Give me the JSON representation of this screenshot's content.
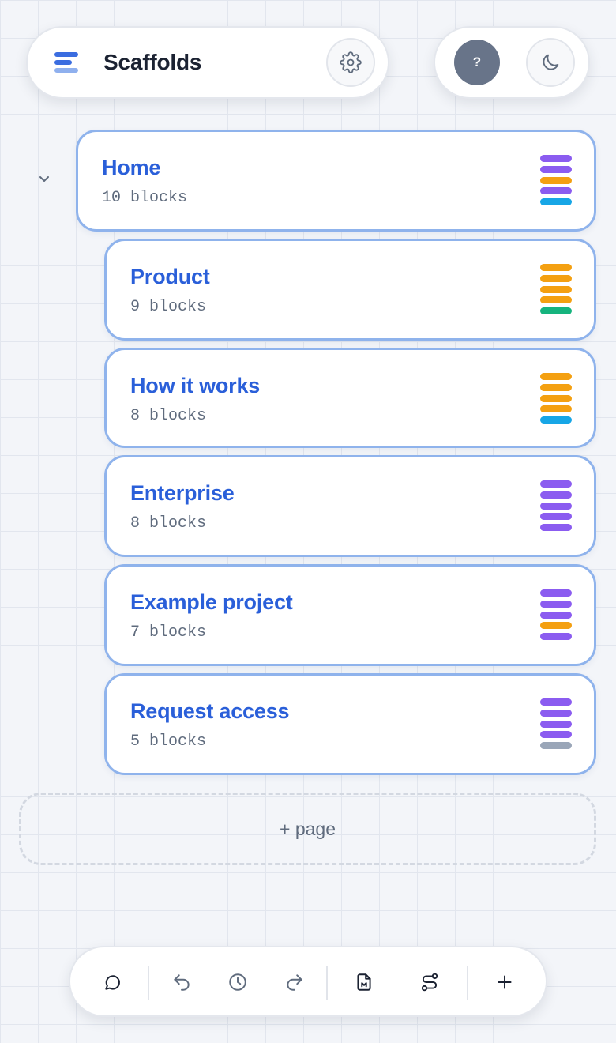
{
  "header": {
    "title": "Scaffolds",
    "logo_icon": "scaffolds-logo-icon",
    "settings_icon": "gear-icon",
    "help_label": "?",
    "theme_icon": "moon-icon"
  },
  "colors": {
    "accent": "#2a5fd9",
    "card_border": "#8fb3ec",
    "purple": "#8b5cf0",
    "orange": "#f4a011",
    "sky": "#17a6e6",
    "green": "#16b47e",
    "gray": "#9aa6b8"
  },
  "pages": [
    {
      "title": "Home",
      "count": "10 blocks",
      "stack": [
        "purple",
        "purple",
        "orange",
        "purple",
        "sky"
      ]
    },
    {
      "title": "Product",
      "count": "9 blocks",
      "stack": [
        "orange",
        "orange",
        "orange",
        "orange",
        "green"
      ]
    },
    {
      "title": "How it works",
      "count": "8 blocks",
      "stack": [
        "orange",
        "orange",
        "orange",
        "orange",
        "sky"
      ]
    },
    {
      "title": "Enterprise",
      "count": "8 blocks",
      "stack": [
        "purple",
        "purple",
        "purple",
        "purple",
        "purple"
      ]
    },
    {
      "title": "Example project",
      "count": "7 blocks",
      "stack": [
        "purple",
        "purple",
        "purple",
        "orange",
        "purple"
      ]
    },
    {
      "title": "Request access",
      "count": "5 blocks",
      "stack": [
        "purple",
        "purple",
        "purple",
        "purple",
        "gray"
      ]
    }
  ],
  "tree": {
    "collapse_icon": "chevron-down-icon"
  },
  "add_page_label": "+ page",
  "toolbar": {
    "items": [
      "comment-icon",
      "undo-icon",
      "history-icon",
      "redo-icon",
      "export-file-icon",
      "route-icon",
      "plus-icon"
    ]
  }
}
